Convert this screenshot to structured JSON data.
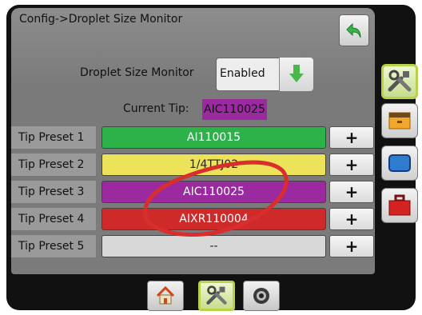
{
  "header": {
    "breadcrumb": "Config->Droplet Size Monitor"
  },
  "droplet_size_monitor": {
    "label": "Droplet Size Monitor",
    "value": "Enabled"
  },
  "current_tip": {
    "label": "Current Tip:",
    "value": "AIC110025",
    "color": "#9b2aa0"
  },
  "presets": [
    {
      "label": "Tip Preset 1",
      "value": "AI110015",
      "color": "#2db24a",
      "text_color": "#ffffff",
      "add": "+"
    },
    {
      "label": "Tip Preset 2",
      "value": "1/4TTJ02",
      "color": "#ece35a",
      "text_color": "#222222",
      "add": "+"
    },
    {
      "label": "Tip Preset 3",
      "value": "AIC110025",
      "color": "#9b2aa0",
      "text_color": "#ffffff",
      "add": "+"
    },
    {
      "label": "Tip Preset 4",
      "value": "AIXR110004",
      "color": "#cf2a2a",
      "text_color": "#ffffff",
      "add": "+"
    },
    {
      "label": "Tip Preset 5",
      "value": "--",
      "color": "#d7d7d7",
      "text_color": "#222222",
      "add": "+"
    }
  ],
  "annotation": {
    "color": "#d92e2e"
  },
  "side_tabs": [
    "tools-icon",
    "folder-icon",
    "display-icon",
    "toolbox-icon"
  ],
  "bottom_tabs": [
    "home-icon",
    "tools-icon",
    "camera-icon"
  ]
}
